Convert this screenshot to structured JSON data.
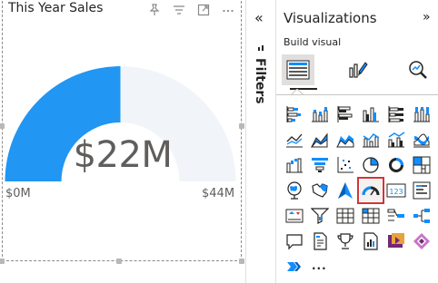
{
  "visual": {
    "title": "This Year Sales",
    "value": "$22M",
    "min_label": "$0M",
    "max_label": "$44M",
    "fill_fraction": 0.5,
    "fill_color": "#2196f3",
    "track_color": "#f1f5fa",
    "tools": [
      "pin-icon",
      "filter-icon",
      "focus-mode-icon",
      "more-options-icon"
    ]
  },
  "filters": {
    "collapse_glyph": "«",
    "label": "Filters"
  },
  "visualizations": {
    "title": "Visualizations",
    "expand_glyph": "»",
    "subtitle": "Build visual",
    "modes": [
      "build-visual-icon",
      "format-visual-icon",
      "analytics-icon"
    ],
    "more_glyph": "...",
    "selected_icon": "gauge-icon",
    "accent_color": "#118dff",
    "selected_border_color": "#d13438",
    "icons": [
      [
        "stacked-bar-icon",
        "stacked-column-icon",
        "clustered-bar-icon",
        "clustered-column-icon",
        "100-stacked-bar-icon",
        "100-stacked-column-icon"
      ],
      [
        "line-chart-icon",
        "area-chart-icon",
        "stacked-area-icon",
        "line-stacked-column-icon",
        "line-clustered-column-icon",
        "ribbon-chart-icon"
      ],
      [
        "waterfall-icon",
        "funnel-icon",
        "scatter-icon",
        "pie-icon",
        "donut-icon",
        "treemap-icon"
      ],
      [
        "map-icon",
        "filled-map-icon",
        "azure-map-icon",
        "gauge-icon",
        "card-icon",
        "multi-row-card-icon"
      ],
      [
        "kpi-icon",
        "slicer-icon",
        "table-icon",
        "matrix-icon",
        "key-influencers-icon",
        "decomposition-tree-icon"
      ],
      [
        "qa-icon",
        "narrative-icon",
        "goals-icon",
        "paginated-report-icon",
        "power-apps-icon",
        "power-automate-icon"
      ],
      [
        "more-visuals-icon"
      ]
    ]
  }
}
